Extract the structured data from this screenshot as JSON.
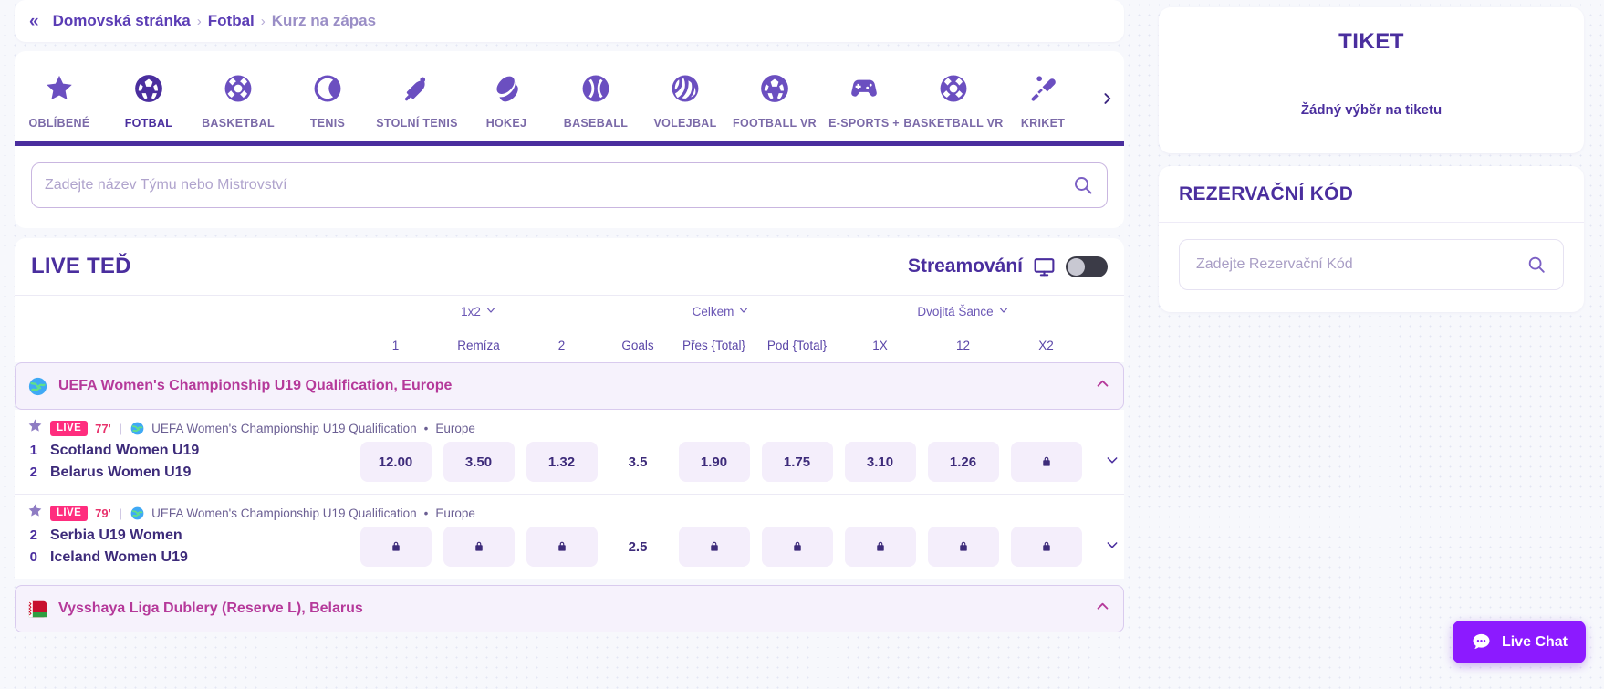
{
  "breadcrumb": {
    "collapse_icon": "«",
    "items": [
      {
        "label": "Domovská stránka"
      },
      {
        "label": "Fotbal"
      },
      {
        "label": "Kurz na zápas"
      }
    ],
    "separator": "›"
  },
  "sports": {
    "items": [
      {
        "label": "OBLÍBENÉ",
        "icon": "star-icon",
        "active": false
      },
      {
        "label": "FOTBAL",
        "icon": "soccer-ball-icon",
        "active": true
      },
      {
        "label": "BASKETBAL",
        "icon": "basketball-icon",
        "active": false
      },
      {
        "label": "TENIS",
        "icon": "tennis-ball-icon",
        "active": false
      },
      {
        "label": "STOLNÍ TENIS",
        "icon": "table-tennis-icon",
        "active": false
      },
      {
        "label": "HOKEJ",
        "icon": "hockey-puck-icon",
        "active": false
      },
      {
        "label": "BASEBALL",
        "icon": "baseball-icon",
        "active": false
      },
      {
        "label": "VOLEJBAL",
        "icon": "volleyball-icon",
        "active": false
      },
      {
        "label": "FOOTBALL VR",
        "icon": "soccer-ball-icon",
        "active": false
      },
      {
        "label": "E-SPORTS +",
        "icon": "gamepad-icon",
        "active": false
      },
      {
        "label": "BASKETBALL VR",
        "icon": "basketball-icon",
        "active": false
      },
      {
        "label": "KRIKET",
        "icon": "cricket-bat-icon",
        "active": false
      }
    ],
    "next_arrow": "›"
  },
  "search": {
    "placeholder": "Zadejte název Týmu nebo Mistrovství",
    "value": "",
    "icon": "search-icon"
  },
  "live": {
    "title": "LIVE TEĎ",
    "stream_label": "Streamování",
    "stream_icon": "monitor-icon",
    "toggle_on": false
  },
  "table": {
    "groups": [
      {
        "label": "1x2",
        "caret": "∨"
      },
      {
        "label": "Celkem",
        "caret": "∨"
      },
      {
        "label": "Dvojitá Šance",
        "caret": "∨"
      }
    ],
    "columns": [
      "1",
      "Remíza",
      "2",
      "Goals",
      "Přes {Total}",
      "Pod {Total}",
      "1X",
      "12",
      "X2"
    ]
  },
  "leagues": [
    {
      "name": "UEFA Women's Championship U19 Qualification, Europe",
      "flag": "globe-icon",
      "collapse_caret": "∧",
      "matches": [
        {
          "live_label": "LIVE",
          "minute": "77'",
          "competition": "UEFA Women's Championship U19 Qualification",
          "region": "Europe",
          "home": {
            "score": "1",
            "name": "Scotland Women U19"
          },
          "away": {
            "score": "2",
            "name": "Belarus Women U19"
          },
          "goals": "3.5",
          "odds": [
            "12.00",
            "3.50",
            "1.32",
            "1.90",
            "1.75",
            "3.10",
            "1.26",
            "lock"
          ],
          "expand_caret": "∨"
        },
        {
          "live_label": "LIVE",
          "minute": "79'",
          "competition": "UEFA Women's Championship U19 Qualification",
          "region": "Europe",
          "home": {
            "score": "2",
            "name": "Serbia U19 Women"
          },
          "away": {
            "score": "0",
            "name": "Iceland Women U19"
          },
          "goals": "2.5",
          "odds": [
            "lock",
            "lock",
            "lock",
            "lock",
            "lock",
            "lock",
            "lock",
            "lock"
          ],
          "expand_caret": "∨"
        }
      ]
    },
    {
      "name": "Vysshaya Liga Dublery (Reserve L), Belarus",
      "flag": "belarus-flag-icon",
      "collapse_caret": "∧",
      "matches": []
    }
  ],
  "betslip": {
    "title": "TIKET",
    "empty_message": "Žádný výběr na tiketu"
  },
  "reservation": {
    "title": "REZERVAČNÍ KÓD",
    "placeholder": "Zadejte Rezervační Kód",
    "value": "",
    "icon": "search-icon"
  },
  "live_chat": {
    "label": "Live Chat",
    "icon": "chat-bubble-icon"
  },
  "colors": {
    "primary": "#4a2e9e",
    "accent_pink": "#b5399a",
    "live_badge": "#ff2d7e",
    "chat": "#8c1aff"
  }
}
